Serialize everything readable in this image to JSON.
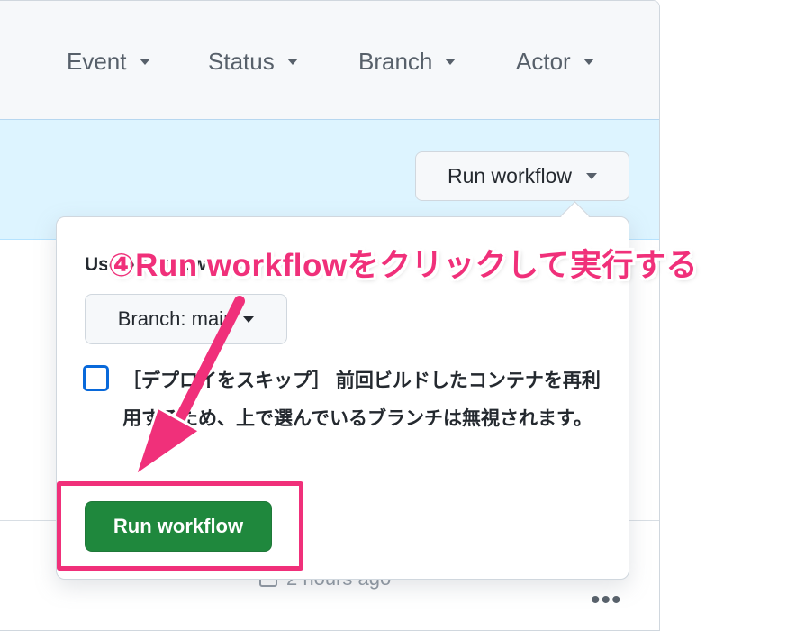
{
  "filters": [
    {
      "label": "Event"
    },
    {
      "label": "Status"
    },
    {
      "label": "Branch"
    },
    {
      "label": "Actor"
    }
  ],
  "banner": {
    "run_button_label": "Run workflow"
  },
  "popover": {
    "use_label": "Use workflow from",
    "branch_label": "Branch: main",
    "skip_checkbox_label": "［デプロイをスキップ］ 前回ビルドしたコンテナを再利用するため、上で選んでいるブランチは無視されます。",
    "skip_checked": false,
    "submit_label": "Run workflow"
  },
  "row": {
    "time_text": "2 hours ago"
  },
  "annotation": {
    "text": "④Run workflowをクリックして実行する",
    "color": "#f0307a"
  },
  "colors": {
    "primary_green": "#1f883d",
    "banner_blue": "#ddf4ff",
    "checkbox_blue": "#0969da"
  }
}
